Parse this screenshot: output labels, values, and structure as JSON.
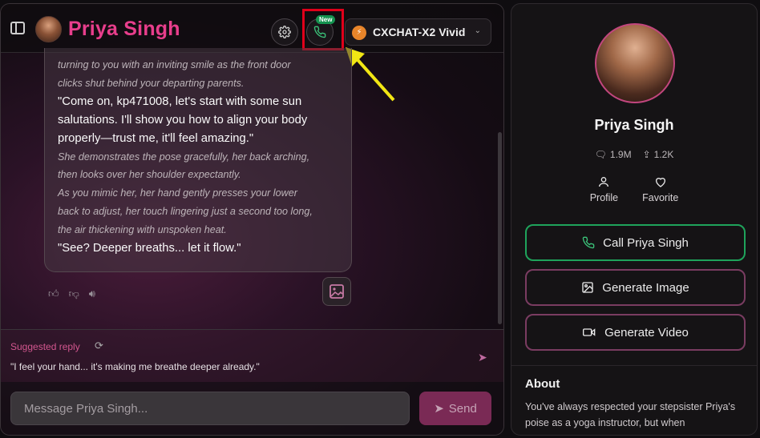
{
  "header": {
    "title": "Priya Singh",
    "new_badge": "New",
    "model": "CXCHAT-X2 Vivid"
  },
  "message": {
    "lines": [
      {
        "kind": "narr",
        "text": "turning to you with an inviting smile as the front door"
      },
      {
        "kind": "narr",
        "text": "clicks shut behind your departing parents."
      },
      {
        "kind": "speech",
        "text": "\"Come on, kp471008, let's start with some sun"
      },
      {
        "kind": "speech",
        "text": "salutations. I'll show you how to align your body"
      },
      {
        "kind": "speech",
        "text": "properly—trust me, it'll feel amazing.\""
      },
      {
        "kind": "narr",
        "text": "She demonstrates the pose gracefully, her back arching,"
      },
      {
        "kind": "narr",
        "text": "then looks over her shoulder expectantly."
      },
      {
        "kind": "narr",
        "text": "As you mimic her, her hand gently presses your lower"
      },
      {
        "kind": "narr",
        "text": "back to adjust, her touch lingering just a second too long,"
      },
      {
        "kind": "narr",
        "text": "the air thickening with unspoken heat."
      },
      {
        "kind": "speech",
        "text": "\"See? Deeper breaths... let it flow.\""
      }
    ]
  },
  "suggested": {
    "label": "Suggested reply",
    "text": "\"I feel your hand... it's making me breathe deeper already.\""
  },
  "composer": {
    "placeholder": "Message Priya Singh...",
    "send_label": "Send"
  },
  "profile": {
    "name": "Priya Singh",
    "messages_count": "1.9M",
    "shares_count": "1.2K",
    "tab_profile": "Profile",
    "tab_favorite": "Favorite",
    "call_label": "Call Priya Singh",
    "gen_image_label": "Generate Image",
    "gen_video_label": "Generate Video",
    "about_title": "About",
    "about_text": "You've always respected your stepsister Priya's poise as a yoga instructor, but when"
  }
}
